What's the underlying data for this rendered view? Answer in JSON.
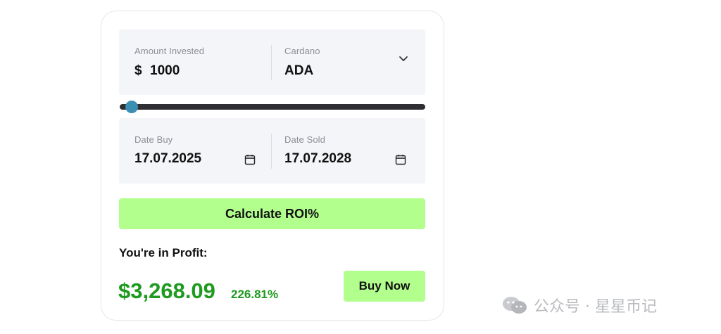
{
  "calculator": {
    "amount_label": "Amount Invested",
    "currency_symbol": "$",
    "amount_value": "1000",
    "coin_label": "Cardano",
    "coin_value": "ADA",
    "slider_position": 0.02,
    "date_buy_label": "Date Buy",
    "date_buy_value": "17.07.2025",
    "date_sold_label": "Date Sold",
    "date_sold_value": "17.07.2028",
    "calculate_button": "Calculate ROI%",
    "profit_label": "You're in Profit:",
    "profit_amount": "$3,268.09",
    "profit_percent": "226.81%",
    "buy_button": "Buy Now"
  },
  "watermark": {
    "text": "公众号 · 星星币记"
  },
  "colors": {
    "accent_button": "#b2ff8e",
    "profit_green": "#1e9a1e",
    "slider_thumb": "#3b8fb3",
    "panel_bg": "#f4f5f8"
  },
  "icons": {
    "dropdown": "chevron-down-icon",
    "calendar": "calendar-icon",
    "watermark": "wechat-icon"
  }
}
